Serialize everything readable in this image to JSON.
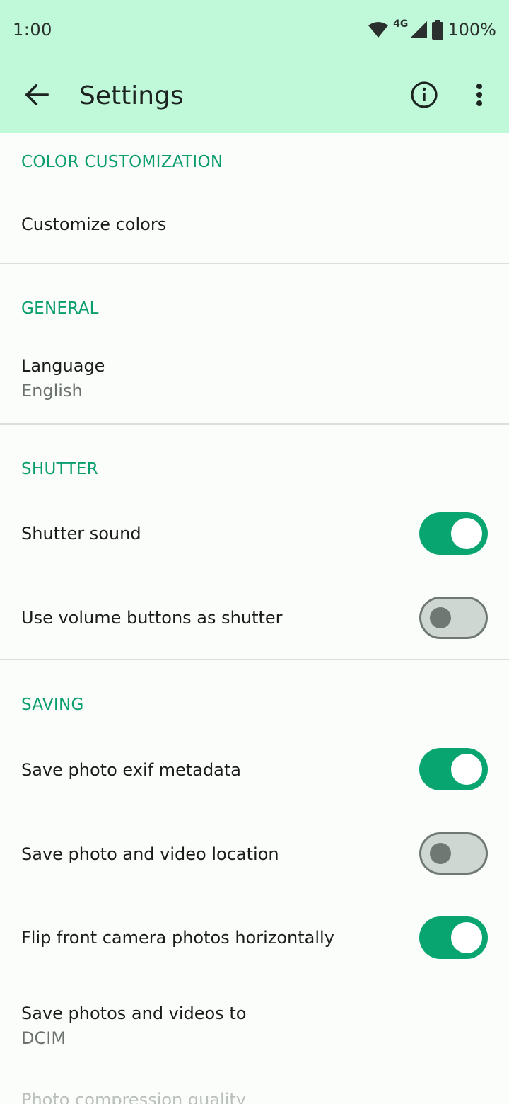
{
  "status_bar": {
    "time": "1:00",
    "network": "4G",
    "battery": "100%",
    "icons": [
      "wifi-icon",
      "cell-signal-icon",
      "battery-icon"
    ]
  },
  "app_bar": {
    "title": "Settings",
    "back_icon": "arrow-back-icon",
    "info_icon": "info-icon",
    "more_icon": "more-vert-icon"
  },
  "colors": {
    "accent": "#0a9d6e",
    "header_bg": "#c0f9da",
    "switch_on": "#08a570",
    "switch_off": "#cfd7d2"
  },
  "sections": {
    "color": {
      "header": "COLOR CUSTOMIZATION",
      "customize_colors": "Customize colors"
    },
    "general": {
      "header": "GENERAL",
      "language_title": "Language",
      "language_value": "English"
    },
    "shutter": {
      "header": "SHUTTER",
      "shutter_sound": "Shutter sound",
      "shutter_sound_on": true,
      "volume_buttons": "Use volume buttons as shutter",
      "volume_buttons_on": false
    },
    "saving": {
      "header": "SAVING",
      "exif": "Save photo exif metadata",
      "exif_on": true,
      "location": "Save photo and video location",
      "location_on": false,
      "flip_front": "Flip front camera photos horizontally",
      "flip_front_on": true,
      "save_to_title": "Save photos and videos to",
      "save_to_value": "DCIM",
      "compression_title": "Photo compression quality"
    }
  }
}
